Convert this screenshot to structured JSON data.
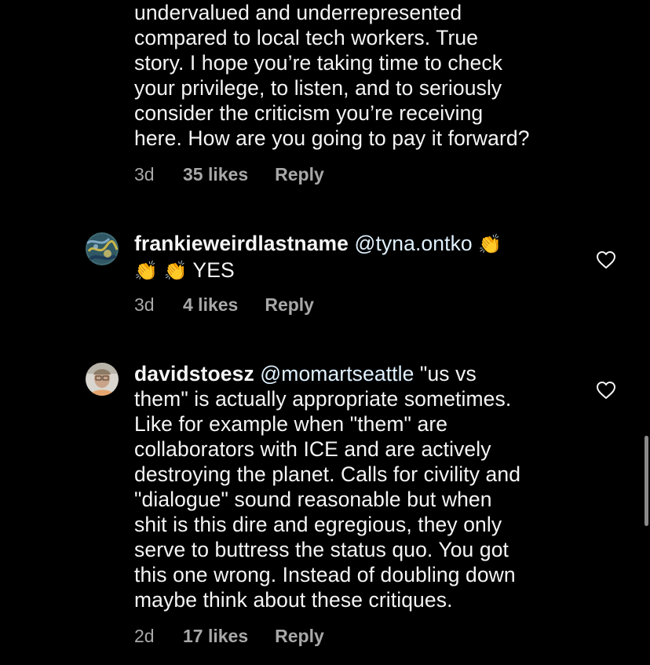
{
  "colors": {
    "background": "#000000",
    "text": "#f5f5f5",
    "mention": "#e0f1ff",
    "meta": "#a8a8a8"
  },
  "comments": [
    {
      "text": "undervalued and underrepresented\ncompared to local tech workers. True\nstory. I hope you’re taking time to check\nyour privilege, to listen, and to seriously\nconsider the criticism you’re receiving\nhere. How are you going to pay it forward?",
      "age": "3d",
      "likes": "35 likes",
      "reply": "Reply"
    },
    {
      "username": "frankieweirdlastname",
      "mention": "@tyna.ontko",
      "emoji_1": "👏",
      "emoji_2": "👏",
      "emoji_3": "👏",
      "text": "YES",
      "age": "3d",
      "likes": "4 likes",
      "reply": "Reply",
      "like_icon": "heart-outline-icon"
    },
    {
      "username": "davidstoesz",
      "mention": "@momartseattle",
      "text": " \"us vs\nthem\" is actually appropriate sometimes.\nLike for example when \"them\" are\ncollaborators with ICE and are actively\ndestroying the planet. Calls for civility and\n\"dialogue\" sound reasonable but when\nshit is this dire and egregious, they only\nserve to buttress the status quo. You got\nthis one wrong. Instead of doubling down\nmaybe think about these critiques.",
      "age": "2d",
      "likes": "17 likes",
      "reply": "Reply",
      "like_icon": "heart-outline-icon"
    }
  ]
}
